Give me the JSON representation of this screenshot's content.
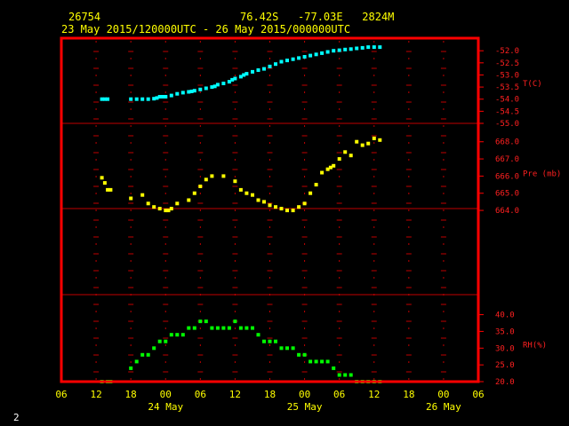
{
  "header": {
    "station": "26754",
    "location": "76.42S   -77.03E   2824M",
    "period": "23 May 2015/120000UTC - 26 May 2015/000000UTC"
  },
  "footer": {
    "page_number": "2"
  },
  "chart_data": {
    "type": "scatter",
    "x_unit": "hours since 2015-05-23 06 UTC",
    "x_range": [
      0,
      72
    ],
    "x_ticks": [
      "06",
      "12",
      "18",
      "00",
      "06",
      "12",
      "18",
      "00",
      "06",
      "12",
      "18",
      "00",
      "06"
    ],
    "date_labels": [
      "24 May",
      "25 May",
      "26 May"
    ],
    "grid": true,
    "panels": [
      {
        "name": "temperature",
        "ylabel": "T(C)",
        "ylim": [
          -55.0,
          -51.7
        ],
        "y_ticks": [
          "-52.0",
          "-52.5",
          "-53.0",
          "-53.5",
          "-54.0",
          "-54.5",
          "-55.0"
        ],
        "color": "#00ffff",
        "x": [
          7,
          7.5,
          8,
          12,
          13,
          14,
          15,
          16,
          16.5,
          17,
          17.5,
          18,
          19,
          20,
          21,
          22,
          22.5,
          23,
          24,
          25,
          26,
          26.5,
          27,
          28,
          29,
          29.5,
          30,
          31,
          31.5,
          32,
          33,
          34,
          35,
          36,
          37,
          38,
          39,
          40,
          41,
          42,
          43,
          44,
          45,
          46,
          47,
          48,
          49,
          50,
          51,
          52,
          53,
          54,
          55
        ],
        "y": [
          -54.0,
          -54.0,
          -54.0,
          -54.0,
          -54.0,
          -54.0,
          -54.0,
          -53.98,
          -53.95,
          -53.9,
          -53.9,
          -53.9,
          -53.85,
          -53.78,
          -53.73,
          -53.7,
          -53.68,
          -53.65,
          -53.6,
          -53.55,
          -53.5,
          -53.47,
          -53.4,
          -53.35,
          -53.28,
          -53.2,
          -53.15,
          -53.07,
          -53.0,
          -52.95,
          -52.87,
          -52.8,
          -52.75,
          -52.65,
          -52.55,
          -52.45,
          -52.4,
          -52.35,
          -52.3,
          -52.25,
          -52.2,
          -52.15,
          -52.1,
          -52.05,
          -52.0,
          -51.98,
          -51.95,
          -51.93,
          -51.9,
          -51.88,
          -51.85,
          -51.85,
          -51.85
        ]
      },
      {
        "name": "pressure",
        "ylabel": "Pre (mb)",
        "ylim": [
          663.9,
          668.4
        ],
        "y_ticks": [
          "668.0",
          "667.0",
          "666.0",
          "665.0",
          "664.0"
        ],
        "color": "#ffff00",
        "x": [
          7,
          7.5,
          8,
          8.5,
          12,
          14,
          15,
          16,
          17,
          18,
          18.5,
          19,
          20,
          22,
          23,
          24,
          25,
          26,
          28,
          30,
          31,
          32,
          33,
          34,
          35,
          36,
          37,
          38,
          39,
          40,
          41,
          42,
          43,
          44,
          45,
          46,
          46.5,
          47,
          48,
          49,
          50,
          51,
          52,
          53,
          54,
          55
        ],
        "y": [
          665.9,
          665.6,
          665.2,
          665.2,
          664.7,
          664.9,
          664.4,
          664.2,
          664.1,
          664.0,
          664.0,
          664.1,
          664.4,
          664.6,
          665.0,
          665.4,
          665.8,
          666.0,
          666.0,
          665.7,
          665.2,
          665.0,
          664.9,
          664.6,
          664.5,
          664.3,
          664.2,
          664.1,
          664.0,
          664.0,
          664.2,
          664.4,
          665.0,
          665.5,
          666.2,
          666.4,
          666.5,
          666.6,
          667.0,
          667.4,
          667.2,
          668.0,
          667.8,
          667.9,
          668.2,
          668.1
        ]
      },
      {
        "name": "humidity",
        "ylabel": "RH(%)",
        "ylim": [
          20.0,
          42.0
        ],
        "y_ticks": [
          "40.0",
          "35.0",
          "30.0",
          "25.0",
          "20.0"
        ],
        "color": "#00ff00",
        "x": [
          7,
          8,
          8.5,
          12,
          13,
          14,
          15,
          16,
          17,
          18,
          19,
          20,
          21,
          22,
          23,
          24,
          25,
          26,
          27,
          28,
          29,
          30,
          31,
          32,
          33,
          34,
          35,
          36,
          37,
          38,
          39,
          40,
          41,
          42,
          43,
          44,
          45,
          46,
          47,
          48,
          49,
          50,
          51,
          52,
          53,
          54,
          55
        ],
        "y": [
          20.0,
          20.0,
          20.0,
          24.0,
          26.0,
          28.0,
          28.0,
          30.0,
          32.0,
          32.0,
          34.0,
          34.0,
          34.0,
          36.0,
          36.0,
          38.0,
          38.0,
          36.0,
          36.0,
          36.0,
          36.0,
          38.0,
          36.0,
          36.0,
          36.0,
          34.0,
          32.0,
          32.0,
          32.0,
          30.0,
          30.0,
          30.0,
          28.0,
          28.0,
          26.0,
          26.0,
          26.0,
          26.0,
          24.0,
          22.0,
          22.0,
          22.0,
          20.0,
          20.0,
          20.0,
          20.0,
          20.0
        ]
      }
    ]
  }
}
